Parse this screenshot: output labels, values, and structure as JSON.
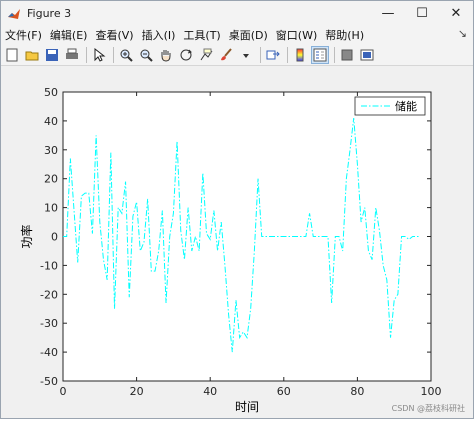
{
  "window": {
    "title": "Figure 3",
    "controls": {
      "minimize": "—",
      "maximize": "☐",
      "close": "✕"
    }
  },
  "menu": {
    "items": [
      "文件(F)",
      "编辑(E)",
      "查看(V)",
      "插入(I)",
      "工具(T)",
      "桌面(D)",
      "窗口(W)",
      "帮助(H)"
    ],
    "overflow": "↘"
  },
  "toolbar": {
    "buttons": [
      "new-figure-icon",
      "open-file-icon",
      "save-icon",
      "print-icon",
      "edit-plot-pointer-icon",
      "zoom-in-icon",
      "zoom-out-icon",
      "pan-hand-icon",
      "rotate-3d-icon",
      "data-cursor-icon",
      "brush-icon",
      "link-plot-icon",
      "insert-colorbar-icon",
      "insert-legend-icon",
      "hide-plot-tools-icon",
      "show-plot-tools-icon"
    ]
  },
  "chart_data": {
    "type": "line",
    "xlabel": "时间",
    "ylabel": "功率",
    "xlim": [
      0,
      100
    ],
    "ylim": [
      -50,
      50
    ],
    "xticks": [
      0,
      20,
      40,
      60,
      80,
      100
    ],
    "yticks": [
      -50,
      -40,
      -30,
      -20,
      -10,
      0,
      10,
      20,
      30,
      40,
      50
    ],
    "grid": false,
    "legend_position": "top-right",
    "series": [
      {
        "name": "储能",
        "color": "#00ffff",
        "line_style": "dash-dot",
        "x": [
          0,
          1,
          2,
          3,
          4,
          5,
          6,
          7,
          8,
          9,
          10,
          11,
          12,
          13,
          14,
          15,
          16,
          17,
          18,
          19,
          20,
          21,
          22,
          23,
          24,
          25,
          26,
          27,
          28,
          29,
          30,
          31,
          32,
          33,
          34,
          35,
          36,
          37,
          38,
          39,
          40,
          41,
          42,
          43,
          44,
          45,
          46,
          47,
          48,
          49,
          50,
          51,
          52,
          53,
          54,
          55,
          60,
          65,
          66,
          67,
          68,
          69,
          70,
          71,
          72,
          73,
          74,
          75,
          76,
          77,
          78,
          79,
          80,
          81,
          82,
          83,
          84,
          85,
          86,
          87,
          88,
          89,
          90,
          91,
          92,
          93,
          94,
          95,
          96,
          97
        ],
        "y": [
          0,
          0,
          27,
          9,
          -9,
          14,
          15,
          15,
          1,
          35,
          5,
          -8,
          -15,
          29,
          -25,
          10,
          8,
          19,
          -21,
          7,
          12,
          -5,
          -2,
          13,
          -12,
          -12,
          -5,
          9,
          -23,
          0,
          8,
          33,
          2,
          -8,
          10,
          -5,
          0,
          -5,
          22,
          1,
          -1,
          9,
          -5,
          5,
          -10,
          -27,
          -40,
          -22,
          -35,
          -33,
          -35,
          -25,
          -5,
          20,
          0,
          0,
          0,
          0,
          0,
          8,
          0,
          0,
          0,
          0,
          0,
          -23,
          0,
          0,
          -5,
          20,
          30,
          41,
          25,
          5,
          10,
          -5,
          -8,
          10,
          2,
          -10,
          -15,
          -35,
          -22,
          -20,
          0,
          0,
          -1,
          0,
          0,
          0
        ]
      }
    ]
  },
  "watermark": "CSDN @荔枝科研社"
}
